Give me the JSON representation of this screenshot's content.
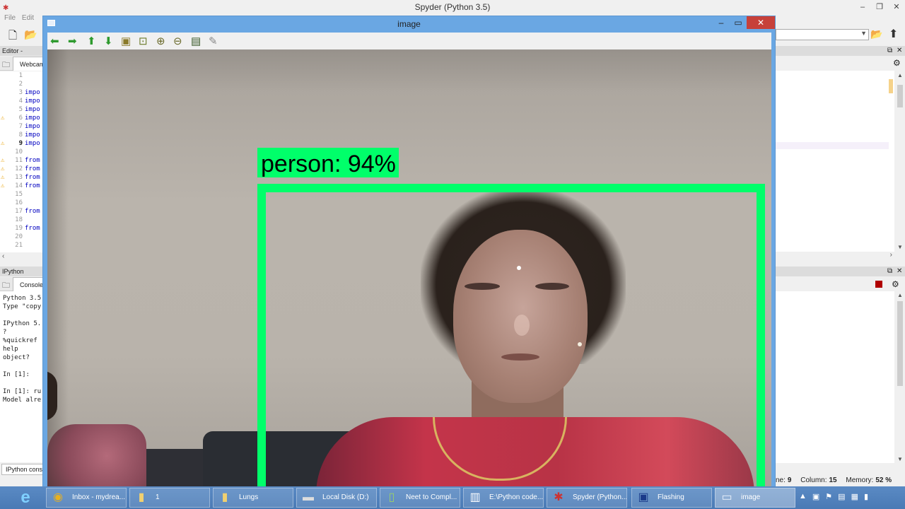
{
  "spyder": {
    "title": "Spyder (Python 3.5)",
    "menu": [
      "File",
      "Edit"
    ],
    "editor": {
      "header": "Editor - D:\\IEEE",
      "tab": "Webcam",
      "lines": [
        {
          "n": "1",
          "code": "",
          "warn": false
        },
        {
          "n": "2",
          "code": "",
          "warn": false
        },
        {
          "n": "3",
          "code": "impo",
          "warn": false
        },
        {
          "n": "4",
          "code": "impo",
          "warn": false
        },
        {
          "n": "5",
          "code": "impo",
          "warn": false
        },
        {
          "n": "6",
          "code": "impo",
          "warn": true
        },
        {
          "n": "7",
          "code": "impo",
          "warn": false
        },
        {
          "n": "8",
          "code": "impo",
          "warn": false
        },
        {
          "n": "9",
          "code": "impo",
          "warn": true,
          "active": true
        },
        {
          "n": "10",
          "code": "",
          "warn": false
        },
        {
          "n": "11",
          "code": "from",
          "warn": true
        },
        {
          "n": "12",
          "code": "from",
          "warn": true
        },
        {
          "n": "13",
          "code": "from",
          "warn": true
        },
        {
          "n": "14",
          "code": "from",
          "warn": true
        },
        {
          "n": "15",
          "code": "",
          "warn": false
        },
        {
          "n": "16",
          "code": "",
          "warn": false
        },
        {
          "n": "17",
          "code": "from",
          "warn": false
        },
        {
          "n": "18",
          "code": "",
          "warn": false
        },
        {
          "n": "19",
          "code": "from",
          "warn": false
        },
        {
          "n": "20",
          "code": "",
          "warn": false
        },
        {
          "n": "21",
          "code": "",
          "warn": false
        }
      ]
    },
    "console": {
      "header": "IPython console",
      "tab": "Console",
      "lines": [
        "Python 3.5.",
        "Type \"copy",
        "",
        "IPython 5.",
        "?",
        "%quickref",
        "help",
        "object?",
        "",
        "In [1]:",
        "",
        "In [1]: ru",
        "Model alre"
      ],
      "bottom_tab": "IPython console"
    },
    "status": {
      "line_label": "ne:",
      "line": "9",
      "column_label": "Column:",
      "column": "15",
      "memory_label": "Memory:",
      "memory": "52 %"
    }
  },
  "image_window": {
    "title": "image",
    "toolbar_icons": [
      "arrow-left-icon",
      "arrow-right-icon",
      "arrow-up-icon",
      "arrow-down-icon",
      "image-icon",
      "fit-icon",
      "zoom-in-icon",
      "zoom-out-icon",
      "save-icon",
      "properties-icon"
    ],
    "detection": {
      "label": "person: 94%",
      "box_color": "#00ff6a"
    }
  },
  "taskbar": {
    "items": [
      {
        "label": "Inbox - mydrea...",
        "icon": "chrome-icon"
      },
      {
        "label": "1",
        "icon": "folder-icon"
      },
      {
        "label": "Lungs",
        "icon": "folder-icon"
      },
      {
        "label": "Local Disk (D:)",
        "icon": "drive-icon"
      },
      {
        "label": "Neet to Compl...",
        "icon": "document-icon"
      },
      {
        "label": "E:\\Python code...",
        "icon": "chart-icon"
      },
      {
        "label": "Spyder (Python...",
        "icon": "spyder-icon"
      },
      {
        "label": "Flashing",
        "icon": "app-icon"
      },
      {
        "label": "image",
        "icon": "window-icon"
      }
    ]
  }
}
